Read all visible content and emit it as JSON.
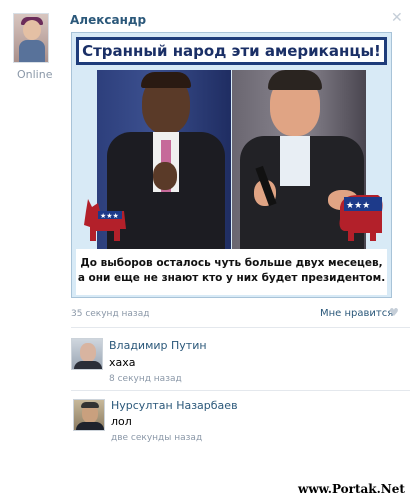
{
  "post": {
    "author": "Александр",
    "status": "Online",
    "close_icon": "close-icon",
    "image": {
      "title": "Странный народ эти американцы!",
      "caption_line1": "До выборов осталось чуть больше двух месецев,",
      "caption_line2": "а они еще не знают кто у них будет президентом.",
      "left_icon": "democrat-donkey-icon",
      "right_icon": "republican-elephant-icon"
    },
    "time": "35 секунд назад",
    "like_label": "Мне нравится",
    "like_icon": "heart-icon"
  },
  "comments": [
    {
      "name": "Владимир Путин",
      "text": "хаха",
      "time": "8 секунд назад"
    },
    {
      "name": "Нурсултан Назарбаев",
      "text": "лол",
      "time": "две секунды назад"
    }
  ],
  "watermark": "www.Portak.Net"
}
